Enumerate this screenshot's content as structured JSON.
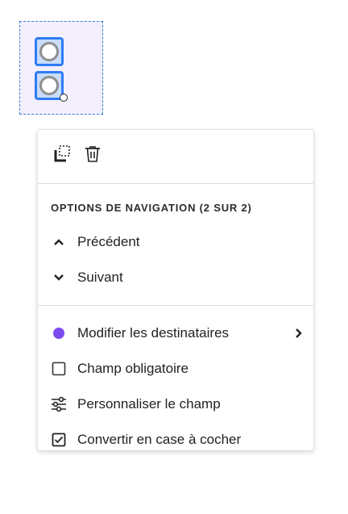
{
  "colors": {
    "selection_blue": "#2f7cf6",
    "recipient_dot": "#7b4bf0",
    "field_background": "#f3effd"
  },
  "toolbar": {
    "icons": [
      "copy-icon",
      "trash-icon"
    ]
  },
  "navigation": {
    "title": "OPTIONS DE NAVIGATION (2 SUR 2)",
    "previous_label": "Précédent",
    "next_label": "Suivant"
  },
  "actions": {
    "items": [
      {
        "label": "Modifier les destinataires",
        "icon": "recipient-dot-icon",
        "has_submenu": true
      },
      {
        "label": "Champ obligatoire",
        "icon": "checkbox-icon",
        "has_submenu": false
      },
      {
        "label": "Personnaliser le champ",
        "icon": "sliders-icon",
        "has_submenu": false
      },
      {
        "label": "Convertir en case à cocher",
        "icon": "checkbox-checked-icon",
        "has_submenu": false
      }
    ]
  }
}
